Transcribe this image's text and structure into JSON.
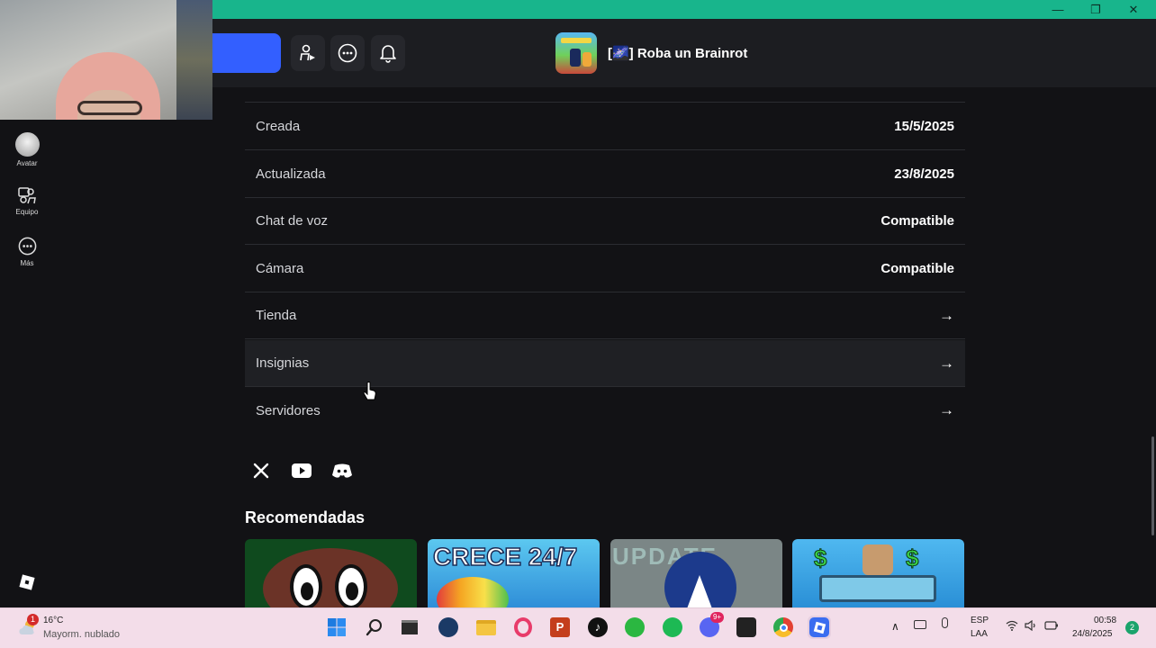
{
  "window": {
    "controls": [
      "—",
      "❐",
      "✕"
    ]
  },
  "toolbar": {
    "game_title": "[🌌] Roba un Brainrot"
  },
  "sidebar": {
    "items": [
      {
        "label": "Avatar"
      },
      {
        "label": "Equipo"
      },
      {
        "label": "Más"
      }
    ]
  },
  "details": {
    "rows": [
      {
        "key": "Creada",
        "value": "15/5/2025"
      },
      {
        "key": "Actualizada",
        "value": "23/8/2025"
      },
      {
        "key": "Chat de voz",
        "value": "Compatible"
      },
      {
        "key": "Cámara",
        "value": "Compatible"
      },
      {
        "key": "Tienda",
        "value": "→"
      },
      {
        "key": "Insignias",
        "value": "→"
      },
      {
        "key": "Servidores",
        "value": "→"
      }
    ]
  },
  "recommended": {
    "title": "Recomendadas",
    "cards": [
      {
        "text": ""
      },
      {
        "text": "CRECE 24/7"
      },
      {
        "text": "UPDATE"
      },
      {
        "text": "$"
      }
    ]
  },
  "taskbar": {
    "weather_temp": "16°C",
    "weather_desc": "Mayorm. nublado",
    "weather_badge": "1",
    "lang_1": "ESP",
    "lang_2": "LAA",
    "time": "00:58",
    "date": "24/8/2025",
    "notif_count": "2",
    "discord_badge": "9+"
  },
  "colors": {
    "accent_blue": "#335fff",
    "title_strip": "#18b58c",
    "background": "#121215"
  }
}
